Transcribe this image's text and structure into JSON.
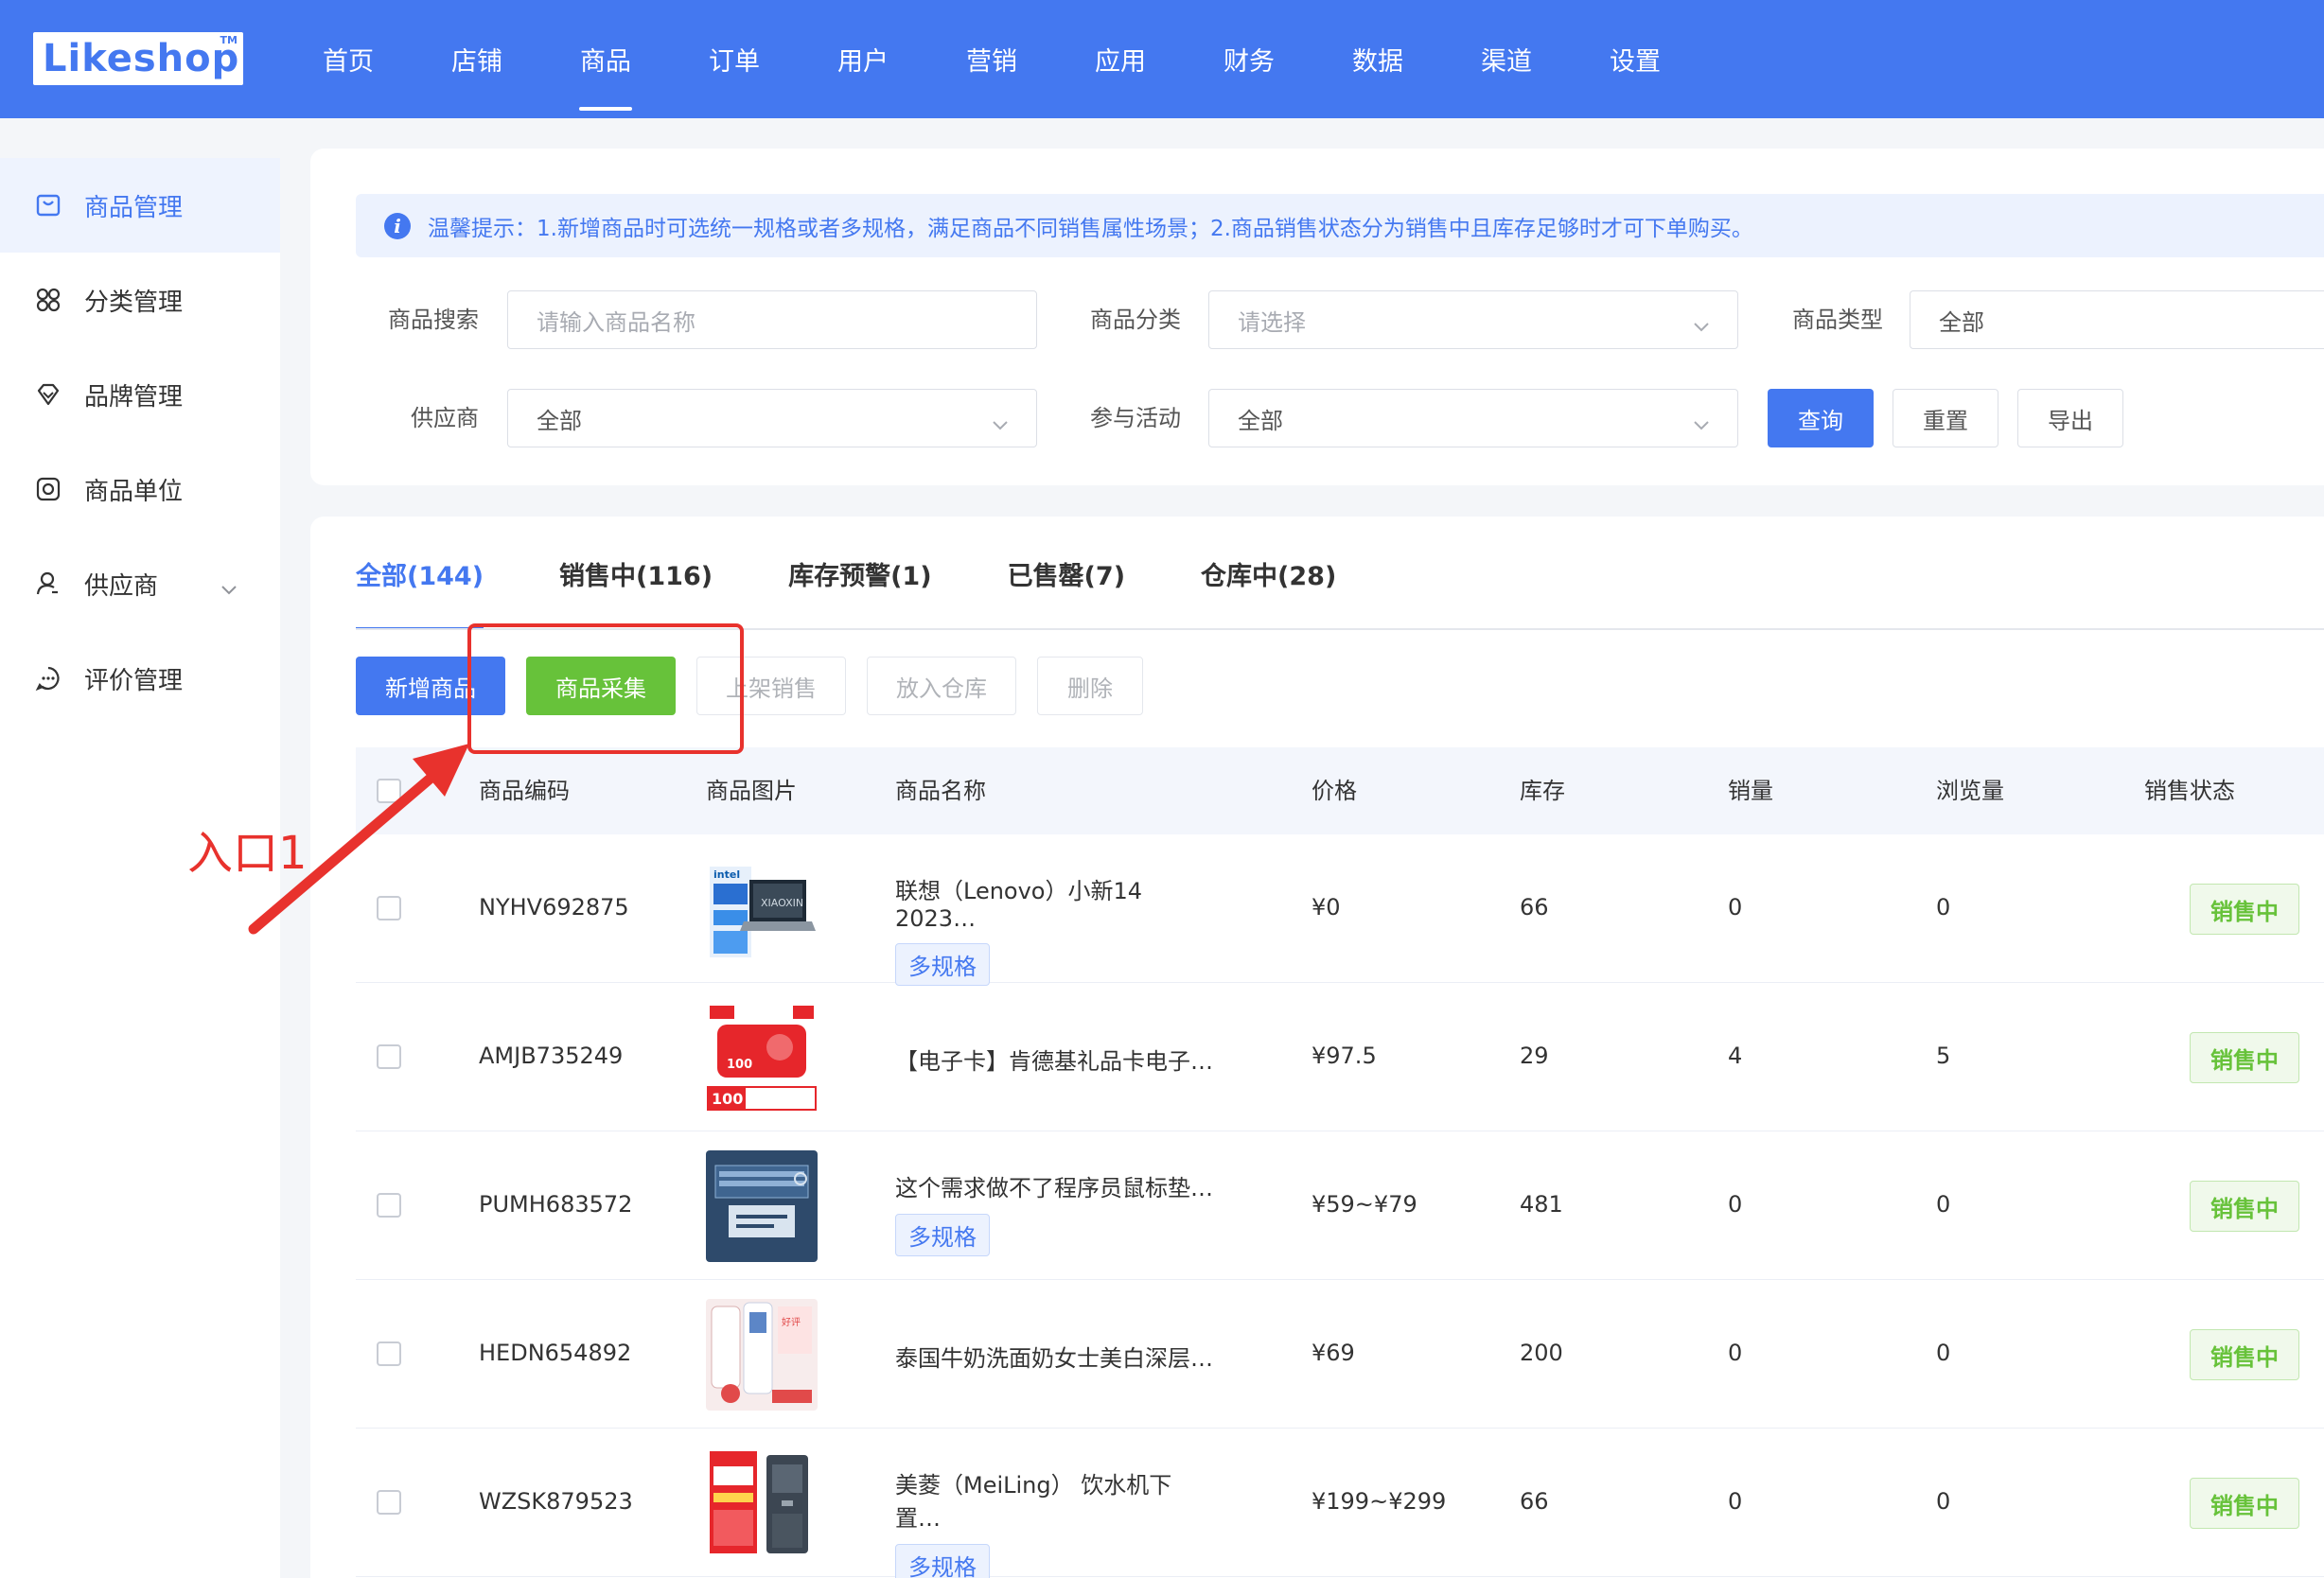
{
  "header": {
    "logo": "Likeshop",
    "logo_tm": "TM",
    "nav": [
      "首页",
      "店铺",
      "商品",
      "订单",
      "用户",
      "营销",
      "应用",
      "财务",
      "数据",
      "渠道",
      "设置"
    ],
    "active_nav": "商品"
  },
  "sidebar": {
    "items": [
      {
        "label": "商品管理",
        "icon": "goods-bag-icon",
        "active": true
      },
      {
        "label": "分类管理",
        "icon": "category-grid-icon"
      },
      {
        "label": "品牌管理",
        "icon": "diamond-icon"
      },
      {
        "label": "商品单位",
        "icon": "unit-box-icon"
      },
      {
        "label": "供应商",
        "icon": "user-icon",
        "has_submenu": true
      },
      {
        "label": "评价管理",
        "icon": "comment-icon"
      }
    ]
  },
  "filters": {
    "tip": "温馨提示：1.新增商品时可选统一规格或者多规格，满足商品不同销售属性场景；2.商品销售状态分为销售中且库存足够时才可下单购买。",
    "search_label": "商品搜索",
    "search_placeholder": "请输入商品名称",
    "category_label": "商品分类",
    "category_placeholder": "请选择",
    "type_label": "商品类型",
    "type_value": "全部",
    "supplier_label": "供应商",
    "supplier_value": "全部",
    "activity_label": "参与活动",
    "activity_value": "全部",
    "query_btn": "查询",
    "reset_btn": "重置",
    "export_btn": "导出"
  },
  "tabs": [
    {
      "label": "全部(144)",
      "active": true
    },
    {
      "label": "销售中(116)"
    },
    {
      "label": "库存预警(1)"
    },
    {
      "label": "已售罄(7)"
    },
    {
      "label": "仓库中(28)"
    }
  ],
  "actions": {
    "add": "新增商品",
    "collect": "商品采集",
    "on_sale": "上架销售",
    "to_warehouse": "放入仓库",
    "delete": "删除"
  },
  "table": {
    "columns": [
      "商品编码",
      "商品图片",
      "商品名称",
      "价格",
      "库存",
      "销量",
      "浏览量",
      "销售状态"
    ],
    "rows": [
      {
        "code": "NYHV692875",
        "name": "联想（Lenovo）小新14 2023…",
        "multi": "多规格",
        "price": "¥0",
        "stock": "66",
        "sales": "0",
        "views": "0",
        "status": "销售中",
        "thumb": "laptop"
      },
      {
        "code": "AMJB735249",
        "name": "【电子卡】肯德基礼品卡电子…",
        "multi": "",
        "price": "¥97.5",
        "stock": "29",
        "sales": "4",
        "views": "5",
        "status": "销售中",
        "thumb": "giftcard"
      },
      {
        "code": "PUMH683572",
        "name": "这个需求做不了程序员鼠标垫…",
        "multi": "多规格",
        "price": "¥59~¥79",
        "stock": "481",
        "sales": "0",
        "views": "0",
        "status": "销售中",
        "thumb": "mousepad"
      },
      {
        "code": "HEDN654892",
        "name": "泰国牛奶洗面奶女士美白深层…",
        "multi": "",
        "price": "¥69",
        "stock": "200",
        "sales": "0",
        "views": "0",
        "status": "销售中",
        "thumb": "cleanser"
      },
      {
        "code": "WZSK879523",
        "name": "美菱（MeiLing） 饮水机下置…",
        "multi": "多规格",
        "price": "¥199~¥299",
        "stock": "66",
        "sales": "0",
        "views": "0",
        "status": "销售中",
        "thumb": "dispenser"
      }
    ]
  },
  "annotation": {
    "label": "入口1",
    "color": "#e8322d"
  },
  "colors": {
    "primary": "#4478f0",
    "success": "#67c23a",
    "danger": "#e8322d"
  }
}
